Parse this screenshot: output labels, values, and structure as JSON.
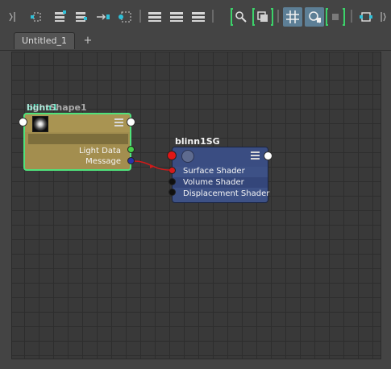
{
  "toolbar": {
    "buttons": [
      {
        "name": "graph-input-connections-icon"
      },
      {
        "name": "graph-input-output-icon"
      },
      {
        "name": "graph-output-connections-icon"
      },
      {
        "name": "show-connected-icon"
      },
      {
        "name": "clear-graph-icon"
      },
      {
        "name": "simple-mode-icon"
      },
      {
        "name": "connected-mode-icon"
      },
      {
        "name": "full-mode-icon"
      },
      {
        "name": "search-node-icon"
      },
      {
        "name": "frame-selection-icon"
      },
      {
        "name": "grid-toggle-icon",
        "active": true
      },
      {
        "name": "snap-to-grid-icon",
        "active": true
      },
      {
        "name": "snap-to-node-icon"
      },
      {
        "name": "view-mode-icon"
      }
    ]
  },
  "tabs": [
    {
      "label": "Untitled_1"
    }
  ],
  "tab_add_label": "+",
  "nodes": {
    "light": {
      "label_primary": "blinn1",
      "label_secondary": "lightShape1",
      "ports": [
        "Light Data",
        "Message"
      ],
      "border_color": "#4fe27b",
      "body_color": "#a38e4f"
    },
    "shading_group": {
      "label": "blinn1SG",
      "ports": [
        "Surface Shader",
        "Volume Shader",
        "Displacement Shader"
      ],
      "body_color": "#3d5186"
    }
  },
  "connection": {
    "from": "Message",
    "to": "Surface Shader",
    "color": "#d11a1a"
  },
  "accent_colors": {
    "active_button": "#5d7f96",
    "bracket": "#3cd26a"
  }
}
